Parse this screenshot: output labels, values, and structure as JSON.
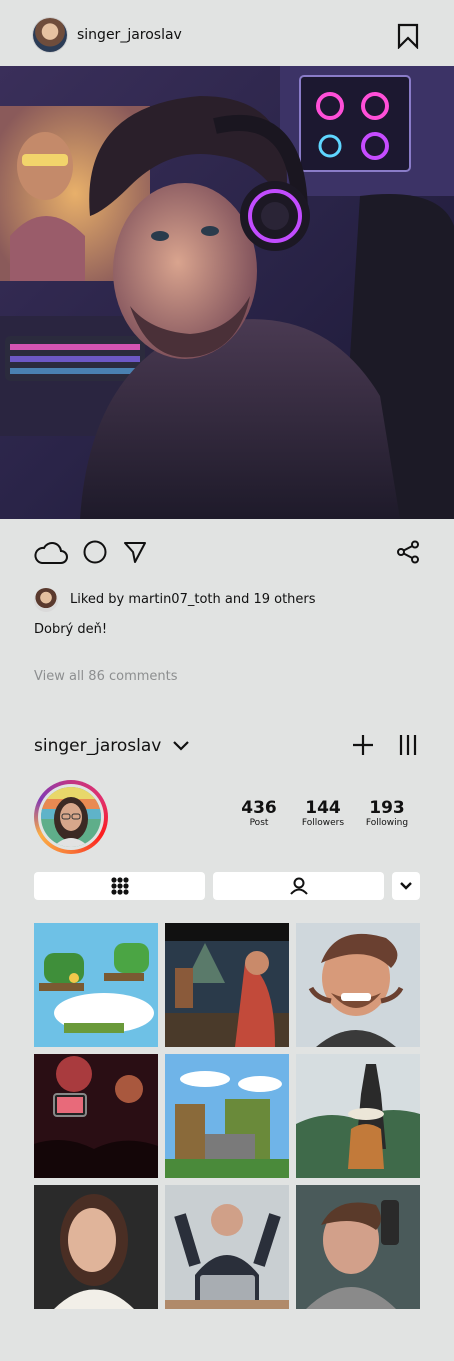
{
  "post": {
    "username": "singer_jaroslav",
    "likes_text": "Liked by martin07_toth and 19 others",
    "caption": "Dobrý deň!",
    "view_comments": "View all 86 comments"
  },
  "icons": {
    "bookmark": "bookmark-icon",
    "like": "cloud-icon",
    "comment": "circle-icon",
    "send": "send-icon",
    "share": "share-icon",
    "add": "plus-icon",
    "menu": "menu-icon",
    "grid": "grid-icon",
    "tagged": "person-icon",
    "more": "chevron-down-icon"
  },
  "profile": {
    "username": "singer_jaroslav",
    "stats": [
      {
        "value": "436",
        "label": "Post"
      },
      {
        "value": "144",
        "label": "Followers"
      },
      {
        "value": "193",
        "label": "Following"
      }
    ]
  },
  "grid": [
    {
      "name": "platformer-game"
    },
    {
      "name": "fighting-game"
    },
    {
      "name": "caricature-man"
    },
    {
      "name": "concert-crowd"
    },
    {
      "name": "pixel-castle-game"
    },
    {
      "name": "woman-at-temple"
    },
    {
      "name": "woman-selfie"
    },
    {
      "name": "excited-businessman"
    },
    {
      "name": "young-man-portrait"
    }
  ],
  "colors": {
    "background": "#e1e3e2",
    "text": "#111111",
    "muted": "#8d8f90",
    "tab_bg": "#ffffff"
  }
}
